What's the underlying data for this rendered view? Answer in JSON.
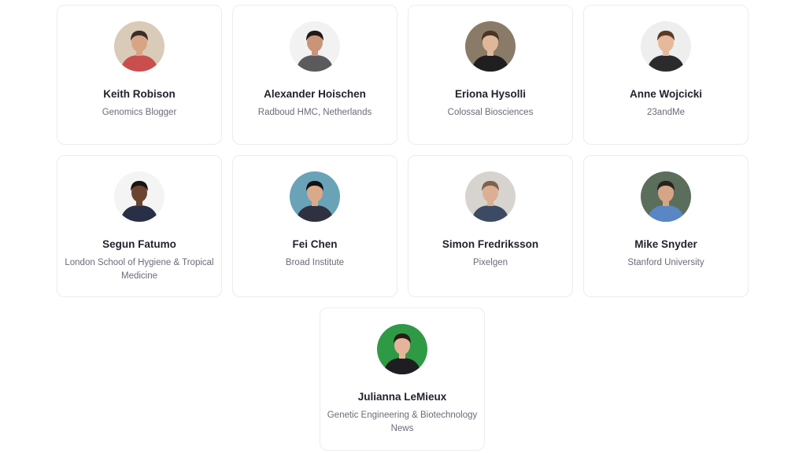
{
  "speakers": [
    {
      "name": "Keith Robison",
      "org": "Genomics Blogger",
      "avatar": {
        "bg": "#d9cbb8",
        "shirt": "#c94f4f",
        "skin": "#d8a485",
        "hair": "#3c2e26"
      }
    },
    {
      "name": "Alexander Hoischen",
      "org": "Radboud HMC, Netherlands",
      "avatar": {
        "bg": "#f2f2f2",
        "shirt": "#5b5b5e",
        "skin": "#c99478",
        "hair": "#1e1a18"
      }
    },
    {
      "name": "Eriona Hysolli",
      "org": "Colossal Biosciences",
      "avatar": {
        "bg": "#8a7b68",
        "shirt": "#1f1f22",
        "skin": "#e0b79a",
        "hair": "#4a3424"
      }
    },
    {
      "name": "Anne Wojcicki",
      "org": "23andMe",
      "avatar": {
        "bg": "#eeeeee",
        "shirt": "#2b2b2e",
        "skin": "#e6b99c",
        "hair": "#5a3b26"
      }
    },
    {
      "name": "Segun Fatumo",
      "org": "London School of Hygiene & Tropical Medicine",
      "avatar": {
        "bg": "#f4f4f4",
        "shirt": "#2a2f48",
        "skin": "#6b4530",
        "hair": "#1b1411"
      }
    },
    {
      "name": "Fei Chen",
      "org": "Broad Institute",
      "avatar": {
        "bg": "#6aa3b7",
        "shirt": "#2f3140",
        "skin": "#d9a98a",
        "hair": "#141214"
      }
    },
    {
      "name": "Simon Fredriksson",
      "org": "Pixelgen",
      "avatar": {
        "bg": "#d7d4cf",
        "shirt": "#3c4a63",
        "skin": "#dcae93",
        "hair": "#7d634d"
      }
    },
    {
      "name": "Mike Snyder",
      "org": "Stanford University",
      "avatar": {
        "bg": "#5b6e5c",
        "shirt": "#5a86c5",
        "skin": "#d5a587",
        "hair": "#2a211c"
      }
    },
    {
      "name": "Julianna LeMieux",
      "org": "Genetic Engineering & Biotechnology News",
      "avatar": {
        "bg": "#2f9a45",
        "shirt": "#1e1e22",
        "skin": "#e4b59a",
        "hair": "#2a1d16"
      }
    }
  ]
}
